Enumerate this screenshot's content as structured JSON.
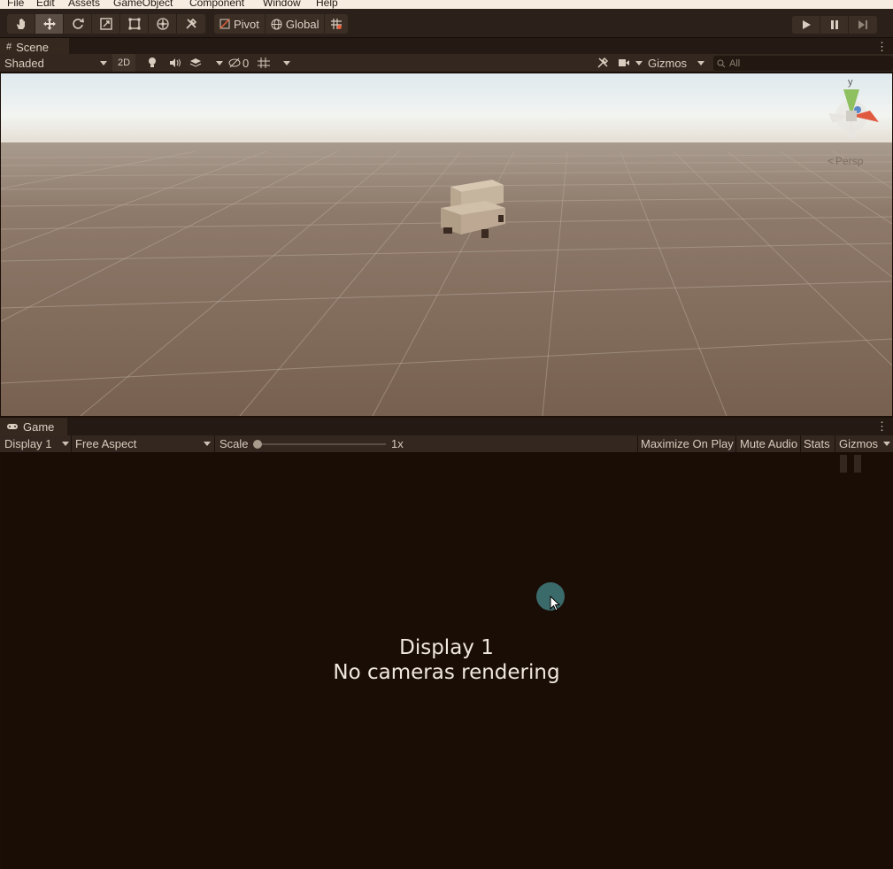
{
  "menu": [
    "File",
    "Edit",
    "Assets",
    "GameObject",
    "Component",
    "Window",
    "Help"
  ],
  "toolbar": {
    "tools": [
      "hand-tool",
      "move-tool",
      "rotate-tool",
      "scale-tool",
      "rect-tool",
      "transform-tool",
      "custom-tool"
    ],
    "pivot_label": "Pivot",
    "global_label": "Global"
  },
  "scene": {
    "tab_label": "Scene",
    "draw_mode": "Shaded",
    "mode_2d": "2D",
    "hidden_count": "0",
    "gizmos_label": "Gizmos",
    "search_placeholder": "All",
    "persp_label": "Persp",
    "axis_y": "y"
  },
  "game": {
    "tab_label": "Game",
    "display": "Display 1",
    "aspect": "Free Aspect",
    "scale_label": "Scale",
    "scale_value": 1,
    "scale_text": "1x",
    "maximize_label": "Maximize On Play",
    "mute_label": "Mute Audio",
    "stats_label": "Stats",
    "gizmos_label": "Gizmos",
    "message_line1": "Display 1",
    "message_line2": "No cameras rendering"
  },
  "colors": {
    "viewport_ground": "#7a6555",
    "sky": "#eaf1f4",
    "game_bg": "#1a0d06",
    "cursor_highlight": "#3b6a6a"
  }
}
